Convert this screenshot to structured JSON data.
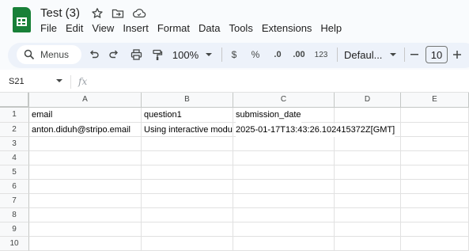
{
  "app": {
    "title": "Test (3)",
    "icons": [
      "star-icon",
      "move-to-folder-icon",
      "cloud-status-icon"
    ]
  },
  "menu": [
    "File",
    "Edit",
    "View",
    "Insert",
    "Format",
    "Data",
    "Tools",
    "Extensions",
    "Help"
  ],
  "toolbar": {
    "search_label": "Menus",
    "zoom": "100%",
    "currency": "$",
    "percent": "%",
    "decrease_decimal": ".0",
    "increase_decimal": ".00",
    "number_format": "123",
    "font": "Defaul...",
    "font_size": "10"
  },
  "formula_bar": {
    "cell_ref": "S21",
    "fx": "fx",
    "value": ""
  },
  "sheet": {
    "columns": [
      "A",
      "B",
      "C",
      "D",
      "E"
    ],
    "rows": [
      "1",
      "2",
      "3",
      "4",
      "5",
      "6",
      "7",
      "8",
      "9",
      "10"
    ],
    "cells": {
      "A1": "email",
      "B1": "question1",
      "C1": "submission_date",
      "A2": "anton.diduh@stripo.email",
      "B2": "Using interactive modu",
      "C2": "2025-01-17T13:43:26.102415372Z[GMT]"
    }
  }
}
